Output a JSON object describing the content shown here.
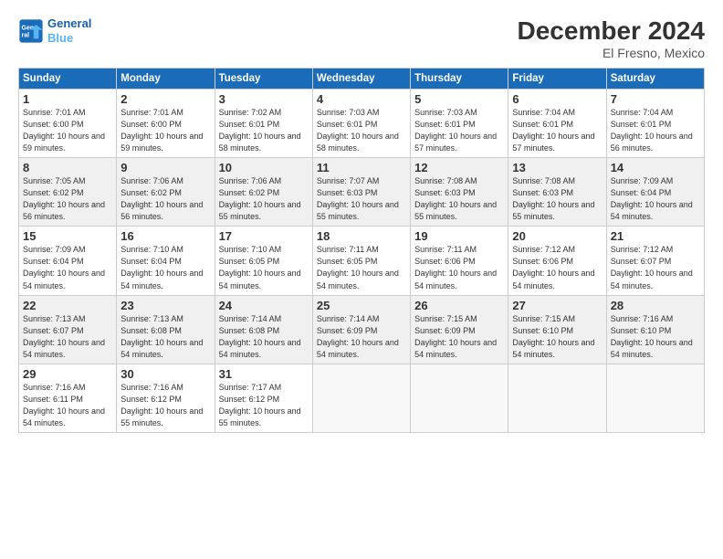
{
  "header": {
    "logo_line1": "General",
    "logo_line2": "Blue",
    "title": "December 2024",
    "subtitle": "El Fresno, Mexico"
  },
  "days_of_week": [
    "Sunday",
    "Monday",
    "Tuesday",
    "Wednesday",
    "Thursday",
    "Friday",
    "Saturday"
  ],
  "weeks": [
    [
      {
        "day": "1",
        "sunrise": "7:01 AM",
        "sunset": "6:00 PM",
        "daylight": "10 hours and 59 minutes."
      },
      {
        "day": "2",
        "sunrise": "7:01 AM",
        "sunset": "6:00 PM",
        "daylight": "10 hours and 59 minutes."
      },
      {
        "day": "3",
        "sunrise": "7:02 AM",
        "sunset": "6:01 PM",
        "daylight": "10 hours and 58 minutes."
      },
      {
        "day": "4",
        "sunrise": "7:03 AM",
        "sunset": "6:01 PM",
        "daylight": "10 hours and 58 minutes."
      },
      {
        "day": "5",
        "sunrise": "7:03 AM",
        "sunset": "6:01 PM",
        "daylight": "10 hours and 57 minutes."
      },
      {
        "day": "6",
        "sunrise": "7:04 AM",
        "sunset": "6:01 PM",
        "daylight": "10 hours and 57 minutes."
      },
      {
        "day": "7",
        "sunrise": "7:04 AM",
        "sunset": "6:01 PM",
        "daylight": "10 hours and 56 minutes."
      }
    ],
    [
      {
        "day": "8",
        "sunrise": "7:05 AM",
        "sunset": "6:02 PM",
        "daylight": "10 hours and 56 minutes."
      },
      {
        "day": "9",
        "sunrise": "7:06 AM",
        "sunset": "6:02 PM",
        "daylight": "10 hours and 56 minutes."
      },
      {
        "day": "10",
        "sunrise": "7:06 AM",
        "sunset": "6:02 PM",
        "daylight": "10 hours and 55 minutes."
      },
      {
        "day": "11",
        "sunrise": "7:07 AM",
        "sunset": "6:03 PM",
        "daylight": "10 hours and 55 minutes."
      },
      {
        "day": "12",
        "sunrise": "7:08 AM",
        "sunset": "6:03 PM",
        "daylight": "10 hours and 55 minutes."
      },
      {
        "day": "13",
        "sunrise": "7:08 AM",
        "sunset": "6:03 PM",
        "daylight": "10 hours and 55 minutes."
      },
      {
        "day": "14",
        "sunrise": "7:09 AM",
        "sunset": "6:04 PM",
        "daylight": "10 hours and 54 minutes."
      }
    ],
    [
      {
        "day": "15",
        "sunrise": "7:09 AM",
        "sunset": "6:04 PM",
        "daylight": "10 hours and 54 minutes."
      },
      {
        "day": "16",
        "sunrise": "7:10 AM",
        "sunset": "6:04 PM",
        "daylight": "10 hours and 54 minutes."
      },
      {
        "day": "17",
        "sunrise": "7:10 AM",
        "sunset": "6:05 PM",
        "daylight": "10 hours and 54 minutes."
      },
      {
        "day": "18",
        "sunrise": "7:11 AM",
        "sunset": "6:05 PM",
        "daylight": "10 hours and 54 minutes."
      },
      {
        "day": "19",
        "sunrise": "7:11 AM",
        "sunset": "6:06 PM",
        "daylight": "10 hours and 54 minutes."
      },
      {
        "day": "20",
        "sunrise": "7:12 AM",
        "sunset": "6:06 PM",
        "daylight": "10 hours and 54 minutes."
      },
      {
        "day": "21",
        "sunrise": "7:12 AM",
        "sunset": "6:07 PM",
        "daylight": "10 hours and 54 minutes."
      }
    ],
    [
      {
        "day": "22",
        "sunrise": "7:13 AM",
        "sunset": "6:07 PM",
        "daylight": "10 hours and 54 minutes."
      },
      {
        "day": "23",
        "sunrise": "7:13 AM",
        "sunset": "6:08 PM",
        "daylight": "10 hours and 54 minutes."
      },
      {
        "day": "24",
        "sunrise": "7:14 AM",
        "sunset": "6:08 PM",
        "daylight": "10 hours and 54 minutes."
      },
      {
        "day": "25",
        "sunrise": "7:14 AM",
        "sunset": "6:09 PM",
        "daylight": "10 hours and 54 minutes."
      },
      {
        "day": "26",
        "sunrise": "7:15 AM",
        "sunset": "6:09 PM",
        "daylight": "10 hours and 54 minutes."
      },
      {
        "day": "27",
        "sunrise": "7:15 AM",
        "sunset": "6:10 PM",
        "daylight": "10 hours and 54 minutes."
      },
      {
        "day": "28",
        "sunrise": "7:16 AM",
        "sunset": "6:10 PM",
        "daylight": "10 hours and 54 minutes."
      }
    ],
    [
      {
        "day": "29",
        "sunrise": "7:16 AM",
        "sunset": "6:11 PM",
        "daylight": "10 hours and 54 minutes."
      },
      {
        "day": "30",
        "sunrise": "7:16 AM",
        "sunset": "6:12 PM",
        "daylight": "10 hours and 55 minutes."
      },
      {
        "day": "31",
        "sunrise": "7:17 AM",
        "sunset": "6:12 PM",
        "daylight": "10 hours and 55 minutes."
      },
      null,
      null,
      null,
      null
    ]
  ]
}
